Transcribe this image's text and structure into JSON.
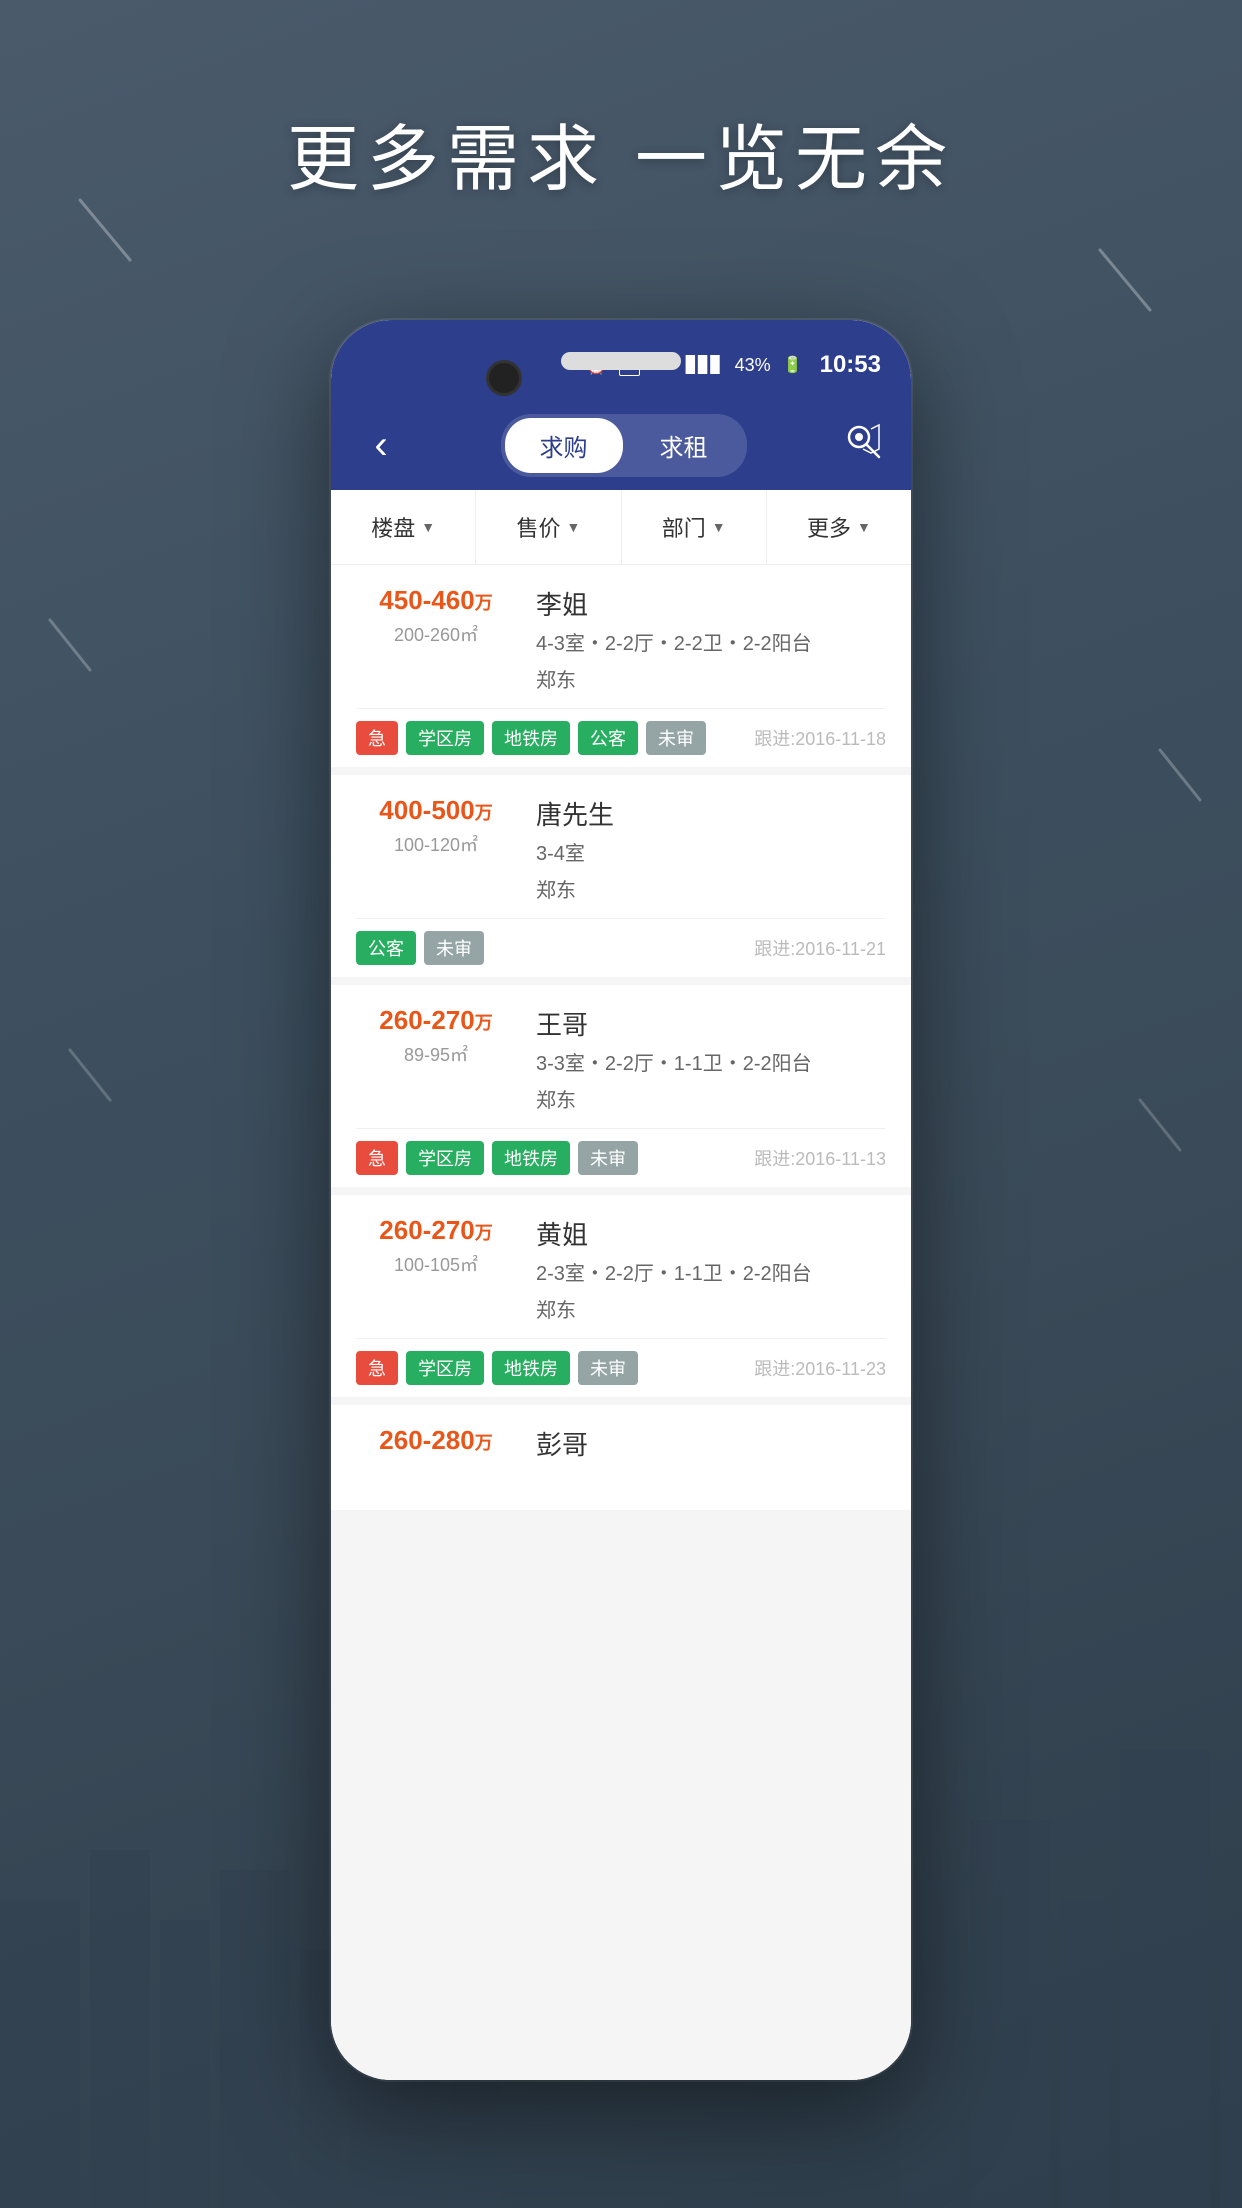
{
  "background": {
    "headline": "更多需求 一览无余"
  },
  "phone": {
    "status_bar": {
      "time": "10:53",
      "battery": "43%",
      "signal": "4G",
      "sim": "1"
    },
    "nav": {
      "back_icon": "‹",
      "tab_buy": "求购",
      "tab_rent": "求租",
      "map_icon": "⊙"
    },
    "filters": [
      {
        "label": "楼盘",
        "has_arrow": true
      },
      {
        "label": "售价",
        "has_arrow": true
      },
      {
        "label": "部门",
        "has_arrow": true
      },
      {
        "label": "更多",
        "has_arrow": true
      }
    ],
    "listings": [
      {
        "price_range": "450-460",
        "price_unit": "万",
        "area": "200-260㎡",
        "name": "李姐",
        "details": "4-3室・2-2厅・2-2卫・2-2阳台",
        "location": "郑东",
        "tags": [
          "急",
          "学区房",
          "地铁房",
          "公客",
          "未审"
        ],
        "tag_types": [
          "urgent",
          "school",
          "metro",
          "public",
          "pending"
        ],
        "follow_date": "跟进:2016-11-18"
      },
      {
        "price_range": "400-500",
        "price_unit": "万",
        "area": "100-120㎡",
        "name": "唐先生",
        "details": "3-4室",
        "location": "郑东",
        "tags": [
          "公客",
          "未审"
        ],
        "tag_types": [
          "public",
          "pending"
        ],
        "follow_date": "跟进:2016-11-21"
      },
      {
        "price_range": "260-270",
        "price_unit": "万",
        "area": "89-95㎡",
        "name": "王哥",
        "details": "3-3室・2-2厅・1-1卫・2-2阳台",
        "location": "郑东",
        "tags": [
          "急",
          "学区房",
          "地铁房",
          "未审"
        ],
        "tag_types": [
          "urgent",
          "school",
          "metro",
          "pending"
        ],
        "follow_date": "跟进:2016-11-13"
      },
      {
        "price_range": "260-270",
        "price_unit": "万",
        "area": "100-105㎡",
        "name": "黄姐",
        "details": "2-3室・2-2厅・1-1卫・2-2阳台",
        "location": "郑东",
        "tags": [
          "急",
          "学区房",
          "地铁房",
          "未审"
        ],
        "tag_types": [
          "urgent",
          "school",
          "metro",
          "pending"
        ],
        "follow_date": "跟进:2016-11-23"
      },
      {
        "price_range": "260-280",
        "price_unit": "万",
        "area": "",
        "name": "彭哥",
        "details": "",
        "location": "",
        "tags": [],
        "tag_types": [],
        "follow_date": ""
      }
    ]
  }
}
